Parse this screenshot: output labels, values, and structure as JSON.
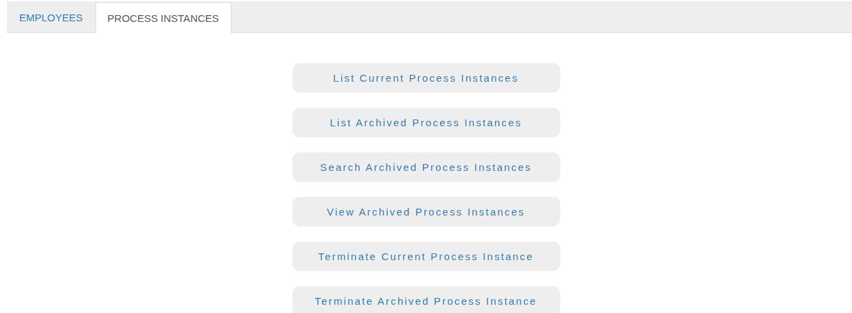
{
  "tabs": [
    {
      "label": "EMPLOYEES",
      "selected": false
    },
    {
      "label": "PROCESS INSTANCES",
      "selected": true
    }
  ],
  "buttons": [
    "List Current Process Instances",
    "List Archived Process Instances",
    "Search Archived Process Instances",
    "View Archived Process Instances",
    "Terminate Current Process Instance",
    "Terminate Archived Process Instance"
  ]
}
